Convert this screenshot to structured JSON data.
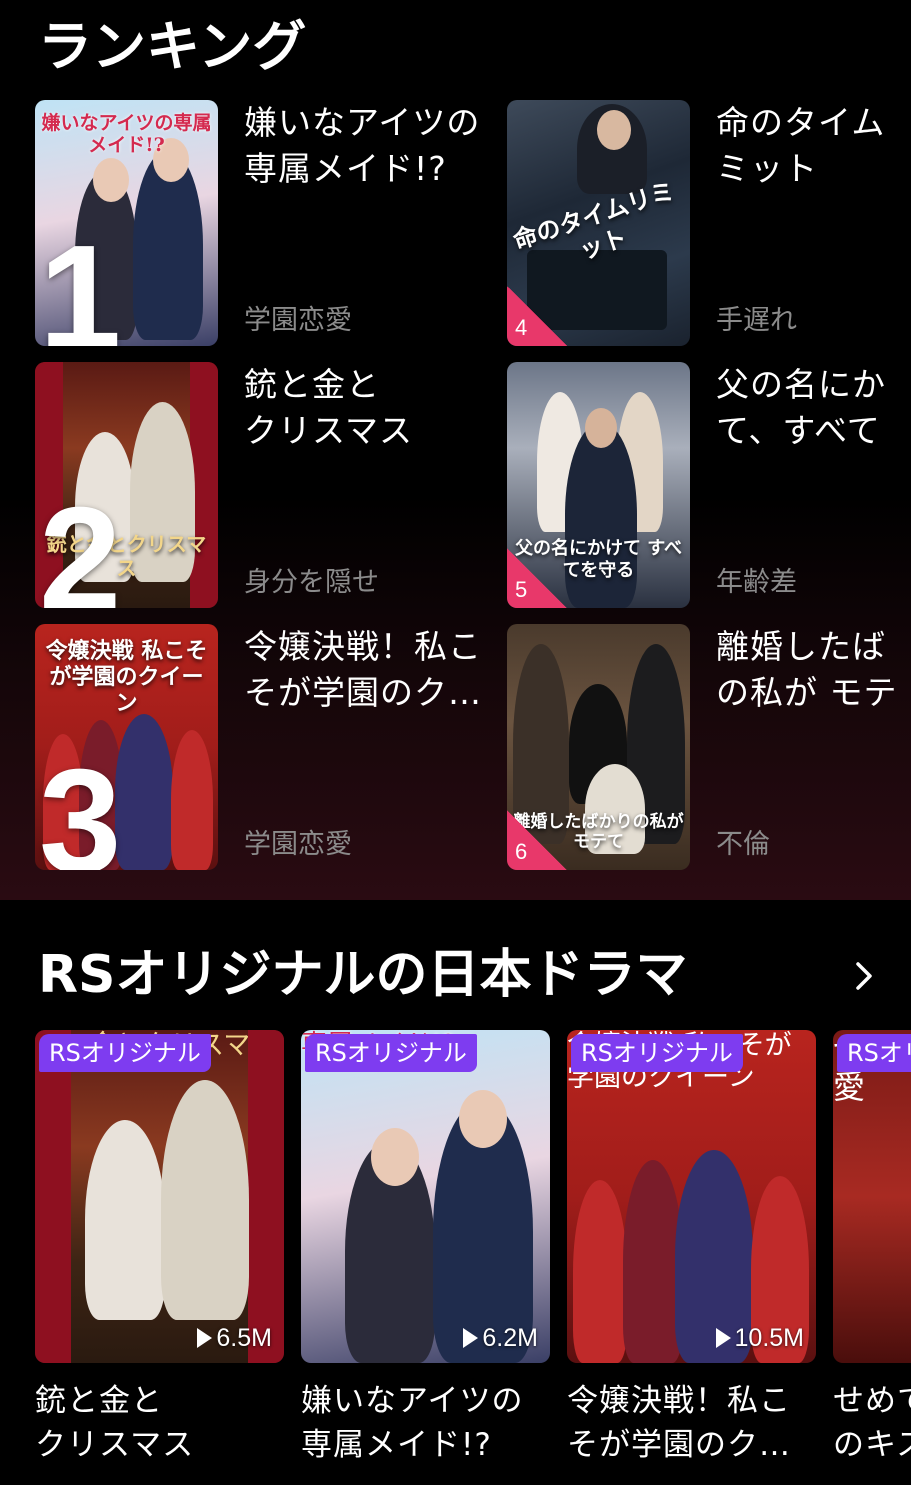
{
  "ranking": {
    "title": "ランキング",
    "items": [
      {
        "rank": "1",
        "title": "嫌いなアイツの\n専属メイド!?",
        "tag": "学園恋愛",
        "poster_title": "嫌いなアイツの専属メイド!?"
      },
      {
        "rank": "2",
        "title": "銃と金と\nクリスマス",
        "tag": "身分を隠せ",
        "poster_title": "銃と金とクリスマス"
      },
      {
        "rank": "3",
        "title": "令嬢決戦！私こ\nそが学園のク…",
        "tag": "学園恋愛",
        "poster_title": "令嬢決戦 私こそが学園のクイーン"
      },
      {
        "rank": "4",
        "title": "命のタイム\nミット",
        "tag": "手遅れ",
        "poster_title": "命のタイムリミット"
      },
      {
        "rank": "5",
        "title": "父の名にか\nて、すべて",
        "tag": "年齢差",
        "poster_title": "父の名にかけて すべてを守る"
      },
      {
        "rank": "6",
        "title": "離婚したば\nの私が モテ",
        "tag": "不倫",
        "poster_title": "離婚したばかりの私がモテて"
      }
    ]
  },
  "rs_originals": {
    "title": "RSオリジナルの日本ドラマ",
    "more_icon": "chevron-right-icon",
    "items": [
      {
        "badge": "RSオリジナル",
        "plays": "6.5M",
        "title": "銃と金と\nクリスマス",
        "poster_title": "銃と金とクリスマス"
      },
      {
        "badge": "RSオリジナル",
        "plays": "6.2M",
        "title": "嫌いなアイツの\n専属メイド!?",
        "poster_title": "専属メイド!?"
      },
      {
        "badge": "RSオリジナル",
        "plays": "10.5M",
        "title": "令嬢決戦！私こ\nそが学園のク…",
        "poster_title": "令嬢決戦 私こそが学園のクイーン"
      },
      {
        "badge": "RSオリ",
        "plays": "",
        "title": "せめて\nのキス",
        "poster_title": "せ 愛"
      }
    ]
  },
  "colors": {
    "background": "#000000",
    "badge": "#7e3cf0",
    "rank_accent": "#e8386a",
    "tag_text": "#8b8b8b"
  }
}
